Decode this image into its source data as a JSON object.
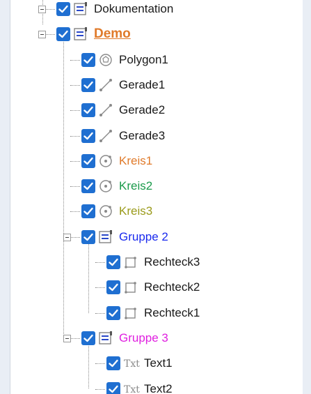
{
  "tree": {
    "top_partial": {
      "label": "Dokumentation",
      "icon": "group-icon",
      "color": "#1a1a1a"
    },
    "group": {
      "label": "Demo",
      "icon": "group-icon",
      "color": "#e07a2a",
      "children": [
        {
          "label": "Polygon1",
          "icon": "polygon-icon",
          "color": "#1a1a1a"
        },
        {
          "label": "Gerade1",
          "icon": "line-icon",
          "color": "#1a1a1a"
        },
        {
          "label": "Gerade2",
          "icon": "line-icon",
          "color": "#1a1a1a"
        },
        {
          "label": "Gerade3",
          "icon": "line-icon",
          "color": "#1a1a1a"
        },
        {
          "label": "Kreis1",
          "icon": "circle-icon",
          "color": "#e07a2a"
        },
        {
          "label": "Kreis2",
          "icon": "circle-icon",
          "color": "#1a9a4a"
        },
        {
          "label": "Kreis3",
          "icon": "circle-icon",
          "color": "#9a9a1a"
        },
        {
          "label": "Gruppe 2",
          "icon": "group-icon",
          "color": "#1a2aee",
          "children": [
            {
              "label": "Rechteck3",
              "icon": "rectangle-icon",
              "color": "#1a1a1a"
            },
            {
              "label": "Rechteck2",
              "icon": "rectangle-icon",
              "color": "#1a1a1a"
            },
            {
              "label": "Rechteck1",
              "icon": "rectangle-icon",
              "color": "#1a1a1a"
            }
          ]
        },
        {
          "label": "Gruppe 3",
          "icon": "group-icon",
          "color": "#e020e0",
          "children": [
            {
              "label": "Text1",
              "icon": "text-icon",
              "color": "#1a1a1a"
            },
            {
              "label": "Text2",
              "icon": "text-icon",
              "color": "#1a1a1a"
            }
          ]
        }
      ]
    }
  }
}
